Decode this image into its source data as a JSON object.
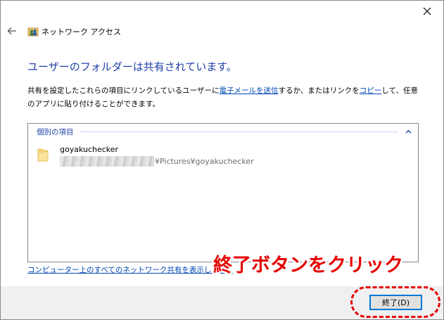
{
  "window": {
    "title": "ネットワーク アクセス",
    "close_icon": "close-icon",
    "back_icon": "back-arrow-icon",
    "title_icon": "network-users-icon"
  },
  "content": {
    "heading": "ユーザーのフォルダーは共有されています。",
    "desc_part1": "共有を設定したこれらの項目にリンクしているユーザーに",
    "desc_email_link": "電子メールを送信",
    "desc_part2": "するか、またはリンクを",
    "desc_copy_link": "コピー",
    "desc_part3": "して、任意のアプリに貼り付けることができます。"
  },
  "items_group": {
    "label": "個別の項目",
    "collapse_icon": "chevron-up-icon",
    "items": [
      {
        "name": "goyakuchecker",
        "path_suffix": "¥Pictures¥goyakuchecker",
        "icon": "folder-icon"
      }
    ]
  },
  "footer": {
    "network_link": "コンピューター上のすべてのネットワーク共有を表示します。",
    "finish_label": "終了(D)"
  },
  "annotation": {
    "text": "終了ボタンをクリック",
    "color": "#e60000"
  },
  "colors": {
    "heading": "#1e3fa8",
    "link": "#0047b3",
    "accent": "#0078d7"
  }
}
